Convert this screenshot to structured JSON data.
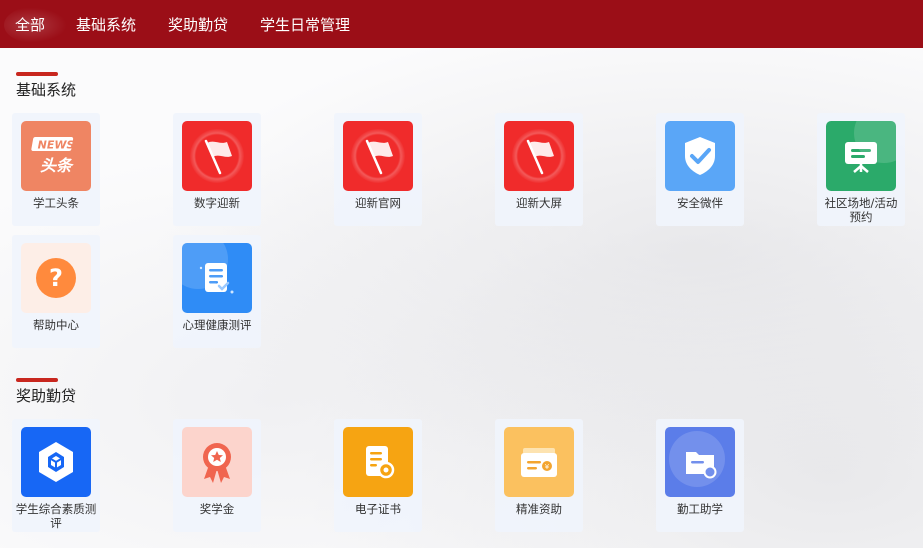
{
  "nav": {
    "items": [
      {
        "label": "全部"
      },
      {
        "label": "基础系统"
      },
      {
        "label": "奖助勤贷"
      },
      {
        "label": "学生日常管理"
      }
    ]
  },
  "sections": [
    {
      "title": "基础系统",
      "apps": [
        {
          "label": "学工头条",
          "icon": "news-headline-icon",
          "color": "#ef8563",
          "icon_text": "NEWS",
          "icon_subtext": "头条"
        },
        {
          "label": "数字迎新",
          "icon": "red-flag-icon",
          "color": "#f02b2b"
        },
        {
          "label": "迎新官网",
          "icon": "red-flag-icon",
          "color": "#f02b2b"
        },
        {
          "label": "迎新大屏",
          "icon": "red-flag-icon",
          "color": "#f02b2b"
        },
        {
          "label": "安全微伴",
          "icon": "shield-check-icon",
          "color": "#5aa6f7"
        },
        {
          "label": "社区场地/活动预约",
          "icon": "presentation-board-icon",
          "color": "#2baa6a"
        },
        {
          "label": "帮助中心",
          "icon": "help-question-icon",
          "color": "#fdeee7"
        },
        {
          "label": "心理健康测评",
          "icon": "document-check-icon",
          "color": "#2f8cf6"
        }
      ]
    },
    {
      "title": "奖助勤贷",
      "apps": [
        {
          "label": "学生综合素质测评",
          "icon": "hexagon-assessment-icon",
          "color": "#1767f5"
        },
        {
          "label": "奖学金",
          "icon": "award-ribbon-icon",
          "color": "#fcd4cc"
        },
        {
          "label": "电子证书",
          "icon": "certificate-icon",
          "color": "#f6a412"
        },
        {
          "label": "精准资助",
          "icon": "money-wallet-icon",
          "color": "#fbc15f"
        },
        {
          "label": "勤工助学",
          "icon": "folder-work-icon",
          "color": "#5b7de9"
        }
      ]
    }
  ],
  "colors": {
    "topbar": "#9b0e17",
    "section_accent": "#c8271f"
  }
}
